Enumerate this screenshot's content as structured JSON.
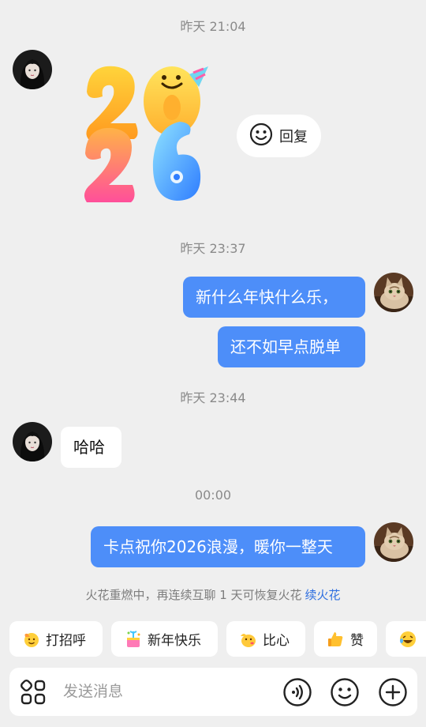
{
  "chat": {
    "timestamps": [
      "昨天 21:04",
      "昨天 23:37",
      "昨天 23:44",
      "00:00"
    ],
    "sticker": {
      "icon": "2026-balloon-sticker"
    },
    "reply_label": "回复",
    "messages": [
      {
        "side": "out",
        "text": "新什么年快什么乐，"
      },
      {
        "side": "out",
        "text": "还不如早点脱单"
      },
      {
        "side": "in",
        "text": "哈哈"
      },
      {
        "side": "out",
        "text": "卡点祝你2026浪漫，暖你一整天"
      }
    ],
    "spark_notice": "火花重燃中，再连续互聊 1 天可恢复火花",
    "spark_link": "续火花"
  },
  "quick_replies": [
    {
      "label": "打招呼",
      "icon": "wave-emoji"
    },
    {
      "label": "新年快乐",
      "icon": "party-emoji"
    },
    {
      "label": "比心",
      "icon": "heart-hands-emoji"
    },
    {
      "label": "赞",
      "icon": "thumbs-up-emoji"
    },
    {
      "label": "",
      "icon": "laughing-emoji"
    }
  ],
  "input": {
    "placeholder": "发送消息",
    "icons": [
      "apps-grid-icon",
      "voice-icon",
      "emoji-icon",
      "plus-icon"
    ]
  },
  "colors": {
    "outgoing_bubble": "#4d8ef9",
    "background": "#efefef",
    "link": "#2f6fe0"
  }
}
